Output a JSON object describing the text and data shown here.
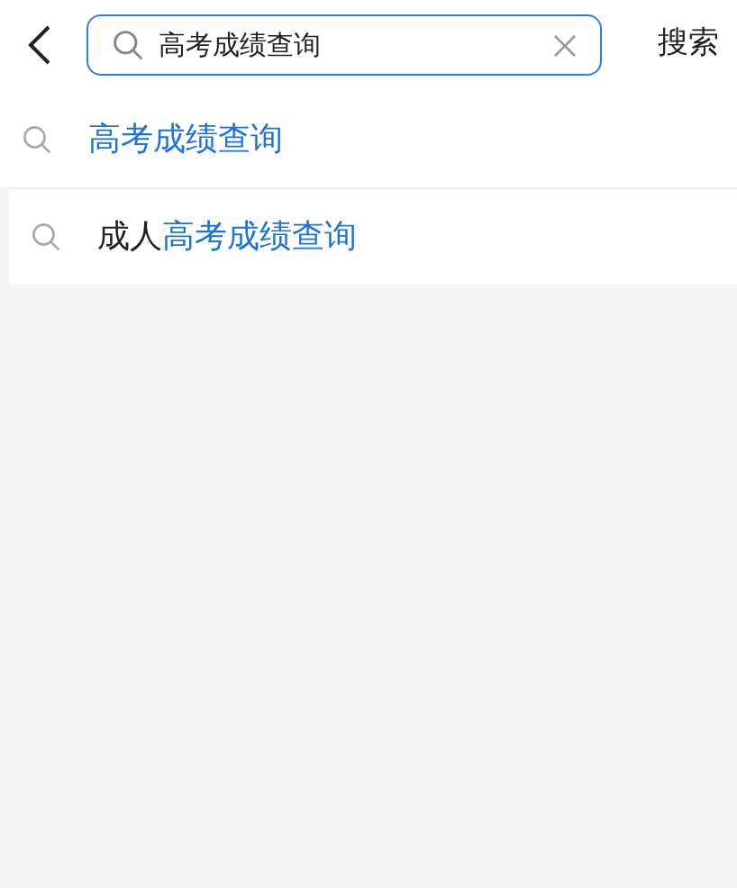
{
  "search": {
    "value": "高考成绩查询",
    "button": "搜索"
  },
  "suggestions": [
    {
      "parts": [
        {
          "text": "高考成绩查询",
          "highlight": true
        }
      ]
    },
    {
      "parts": [
        {
          "text": "成人",
          "highlight": false
        },
        {
          "text": "高考成绩查询",
          "highlight": true
        }
      ]
    }
  ]
}
